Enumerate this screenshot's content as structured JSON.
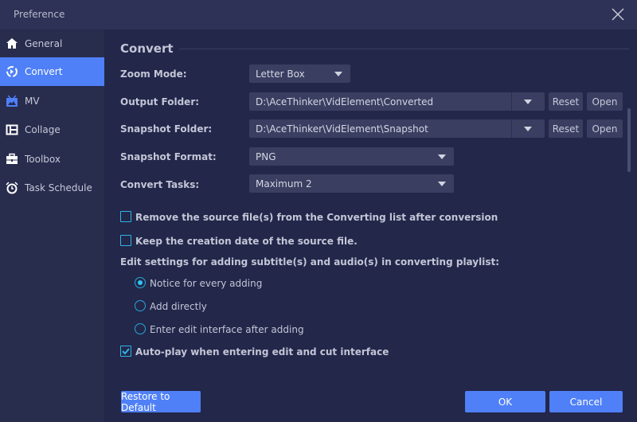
{
  "window": {
    "title": "Preference"
  },
  "sidebar": {
    "items": [
      {
        "label": "General",
        "icon": "home-icon"
      },
      {
        "label": "Convert",
        "icon": "convert-icon",
        "active": true
      },
      {
        "label": "MV",
        "icon": "mv-icon"
      },
      {
        "label": "Collage",
        "icon": "collage-icon"
      },
      {
        "label": "Toolbox",
        "icon": "toolbox-icon"
      },
      {
        "label": "Task Schedule",
        "icon": "alarm-clock-icon"
      }
    ]
  },
  "main": {
    "heading": "Convert",
    "zoom_mode": {
      "label": "Zoom Mode:",
      "value": "Letter Box"
    },
    "output_folder": {
      "label": "Output Folder:",
      "value": "D:\\AceThinker\\VidElement\\Converted",
      "reset": "Reset",
      "open": "Open"
    },
    "snapshot_folder": {
      "label": "Snapshot Folder:",
      "value": "D:\\AceThinker\\VidElement\\Snapshot",
      "reset": "Reset",
      "open": "Open"
    },
    "snapshot_format": {
      "label": "Snapshot Format:",
      "value": "PNG"
    },
    "convert_tasks": {
      "label": "Convert Tasks:",
      "value": "Maximum 2"
    },
    "remove_source": {
      "label": "Remove the source file(s) from the Converting list after conversion",
      "checked": false
    },
    "keep_date": {
      "label": "Keep the creation date of the source file.",
      "checked": false
    },
    "edit_settings_label": "Edit settings for adding subtitle(s) and audio(s) in converting playlist:",
    "radio_options": [
      {
        "label": "Notice for every adding",
        "selected": true
      },
      {
        "label": "Add directly",
        "selected": false
      },
      {
        "label": "Enter edit interface after adding",
        "selected": false
      }
    ],
    "autoplay": {
      "label": "Auto-play when entering edit and cut interface",
      "checked": true
    }
  },
  "footer": {
    "restore": "Restore to Default",
    "ok": "OK",
    "cancel": "Cancel"
  },
  "colors": {
    "accent": "#4f80f7",
    "checkbox": "#2fb4e6",
    "background": "#23274a",
    "sidebar": "#282c4d"
  }
}
